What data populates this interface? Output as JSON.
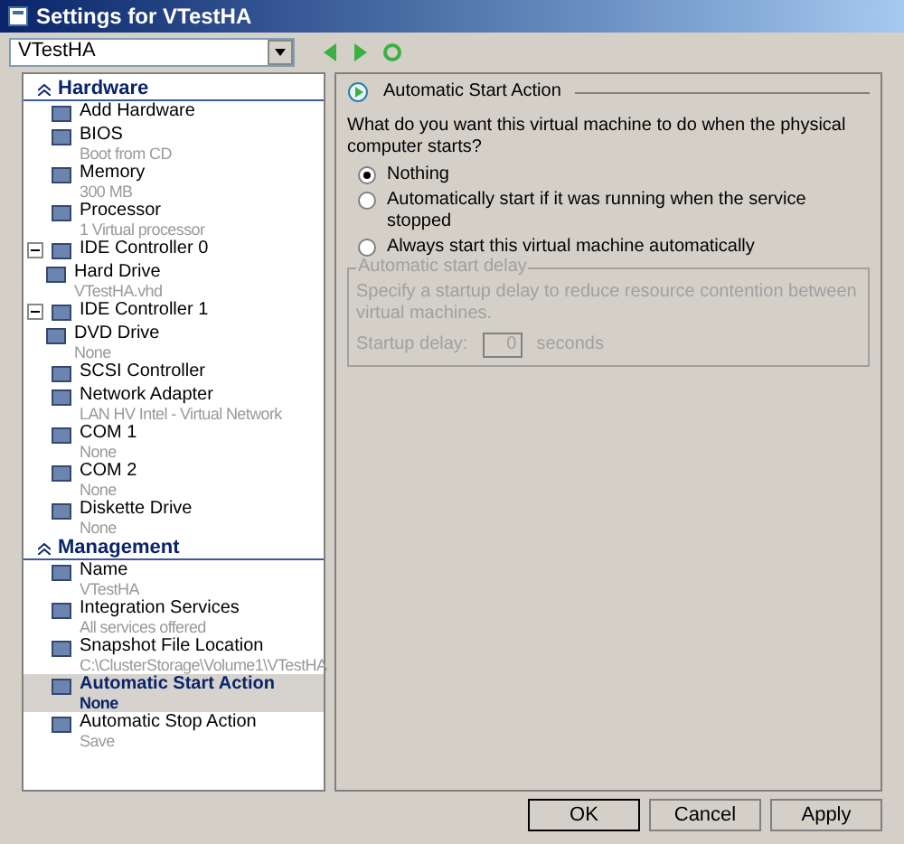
{
  "window": {
    "title": "Settings for VTestHA"
  },
  "vm_selector": {
    "value": "VTestHA"
  },
  "tree": [
    {
      "label": "Hardware",
      "expanded": true,
      "children": [
        {
          "label": "Add Hardware",
          "selected": false
        },
        {
          "label": "BIOS",
          "detail": "Boot from CD",
          "selected": false
        },
        {
          "label": "Memory",
          "detail": "300 MB",
          "selected": false
        },
        {
          "label": "Processor",
          "detail": "1 Virtual processor",
          "selected": false
        },
        {
          "label": "IDE Controller 0",
          "selected": false,
          "expanded": true,
          "children": [
            {
              "label": "Hard Drive",
              "detail": "VTestHA.vhd",
              "selected": false
            }
          ]
        },
        {
          "label": "IDE Controller 1",
          "selected": false,
          "expanded": true,
          "children": [
            {
              "label": "DVD Drive",
              "detail": "None",
              "selected": false
            }
          ]
        },
        {
          "label": "SCSI Controller",
          "selected": false
        },
        {
          "label": "Network Adapter",
          "detail": "LAN HV Intel - Virtual Network",
          "selected": false
        },
        {
          "label": "COM 1",
          "detail": "None",
          "selected": false
        },
        {
          "label": "COM 2",
          "detail": "None",
          "selected": false
        },
        {
          "label": "Diskette Drive",
          "detail": "None",
          "selected": false
        }
      ]
    },
    {
      "label": "Management",
      "expanded": true,
      "children": [
        {
          "label": "Name",
          "detail": "VTestHA",
          "selected": false
        },
        {
          "label": "Integration Services",
          "detail": "All services offered",
          "selected": false
        },
        {
          "label": "Snapshot File Location",
          "detail": "C:\\ClusterStorage\\Volume1\\VTestHA",
          "selected": false
        },
        {
          "label": "Automatic Start Action",
          "detail": "None",
          "selected": true
        },
        {
          "label": "Automatic Stop Action",
          "detail": "Save",
          "selected": false
        }
      ]
    }
  ],
  "panel": {
    "title": "Automatic Start Action",
    "question": "What do you want this virtual machine to do when the physical computer starts?",
    "options": [
      {
        "label": "Nothing",
        "selected": true
      },
      {
        "label": "Automatically start if it was running when the service stopped",
        "selected": false
      },
      {
        "label": "Always start this virtual machine automatically",
        "selected": false
      }
    ],
    "delay_group": {
      "title": "Automatic start delay",
      "disabled": true,
      "description": "Specify a startup delay to reduce resource contention between virtual machines.",
      "field_label": "Startup delay:",
      "value": "0",
      "unit": "seconds"
    }
  },
  "buttons": [
    "OK",
    "Cancel",
    "Apply"
  ]
}
